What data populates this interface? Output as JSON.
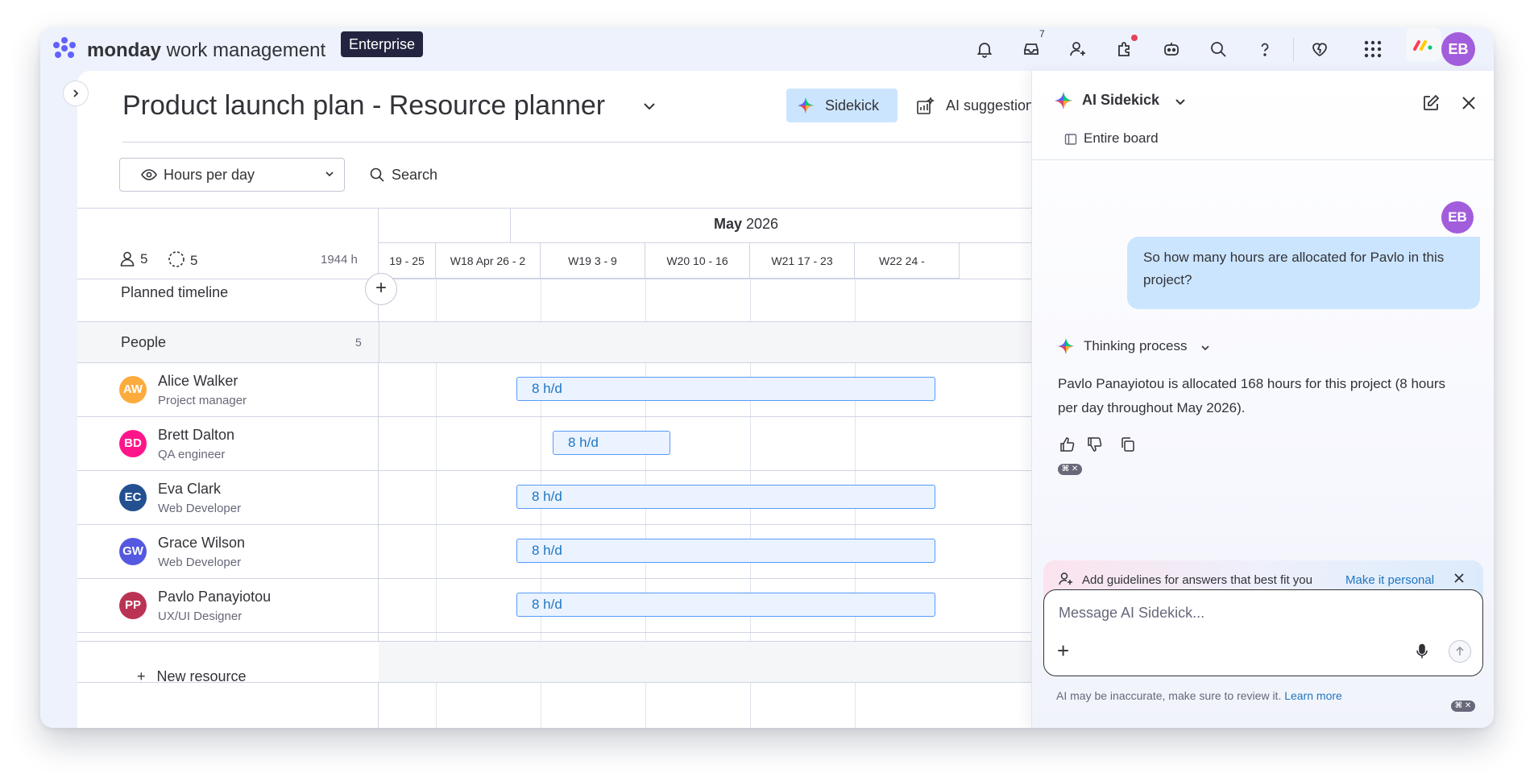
{
  "app": {
    "brand_bold": "monday",
    "brand_rest": " work management",
    "plan_badge": "Enterprise",
    "inbox_count": "7",
    "user_initials": "EB",
    "accent": "#0073ea"
  },
  "board": {
    "title": "Product launch plan - Resource planner",
    "sidekick_button": "Sidekick",
    "ai_suggestions_button": "AI suggestion",
    "view_select": "Hours per day",
    "search_label": "Search"
  },
  "grid": {
    "people_count": "5",
    "placeholder_count": "5",
    "total_hours": "1944 h",
    "planned_timeline_label": "Planned timeline",
    "group_label": "People",
    "group_count": "5",
    "month_bold": "May",
    "month_year": " 2026",
    "weeks": [
      "19 - 25",
      "W18 Apr 26 - 2",
      "W19 3 - 9",
      "W20 10 - 16",
      "W21 17 - 23",
      "W22 24 -"
    ],
    "new_resource_label": "New resource",
    "people": [
      {
        "initials": "AW",
        "name": "Alice Walker",
        "role": "Project manager",
        "color": "#fdab3d",
        "allocation": "8 h/d"
      },
      {
        "initials": "BD",
        "name": "Brett Dalton",
        "role": "QA engineer",
        "color": "#ff158a",
        "allocation": "8 h/d"
      },
      {
        "initials": "EC",
        "name": "Eva Clark",
        "role": "Web Developer",
        "color": "#225091",
        "allocation": "8 h/d"
      },
      {
        "initials": "GW",
        "name": "Grace Wilson",
        "role": "Web Developer",
        "color": "#5559df",
        "allocation": "8 h/d"
      },
      {
        "initials": "PP",
        "name": "Pavlo Panayiotou",
        "role": "UX/UI Designer",
        "color": "#bb3354",
        "allocation": "8 h/d"
      }
    ]
  },
  "sidekick": {
    "title": "AI Sidekick",
    "scope": "Entire board",
    "user_initials": "EB",
    "user_message": "So how many hours are allocated for Pavlo in this project?",
    "thinking_label": "Thinking process",
    "answer": "Pavlo Panayiotou is allocated 168 hours for this project (8 hours per day throughout May 2026).",
    "guidelines_text": "Add guidelines for answers that best fit you",
    "guidelines_link": "Make it personal",
    "input_placeholder": "Message AI Sidekick...",
    "disclaimer": "AI may be inaccurate, make sure to review it.",
    "learn_more": "Learn more"
  }
}
